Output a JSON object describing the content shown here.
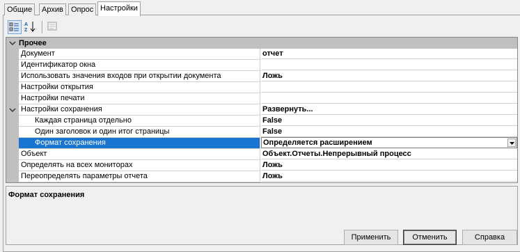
{
  "tabs": [
    "Общие",
    "Архив",
    "Опрос",
    "Настройки"
  ],
  "active_tab": "Настройки",
  "toolbar": {
    "categorized_icon": "categorized-view-icon",
    "alphabetical_icon": "sort-alphabetical-icon",
    "property_pages_icon": "property-pages-icon"
  },
  "grid": {
    "category": "Прочее",
    "rows": [
      {
        "label": "Документ",
        "value": "отчет"
      },
      {
        "label": "Идентификатор окна",
        "value": ""
      },
      {
        "label": "Использовать значения входов при открытии документа",
        "value": "Ложь"
      },
      {
        "label": "Настройки открытия",
        "value": ""
      },
      {
        "label": "Настройки печати",
        "value": ""
      },
      {
        "label": "Настройки сохранения",
        "value": "Развернуть..."
      },
      {
        "label": "Каждая страница отдельно",
        "value": "False"
      },
      {
        "label": "Один заголовок и один итог страницы",
        "value": "False"
      },
      {
        "label": "Формат сохранения",
        "value": "Определяется расширением"
      },
      {
        "label": "Объект",
        "value": "Объект.Отчеты.Непрерывный процесс"
      },
      {
        "label": "Определять на всех мониторах",
        "value": "Ложь"
      },
      {
        "label": "Переопределять параметры отчета",
        "value": "Ложь"
      }
    ]
  },
  "description": {
    "title": "Формат сохранения"
  },
  "buttons": {
    "apply": "Применить",
    "cancel": "Отменить",
    "help": "Справка"
  },
  "colors": {
    "selection": "#1874d1",
    "category_bg": "#c0c0c0"
  }
}
